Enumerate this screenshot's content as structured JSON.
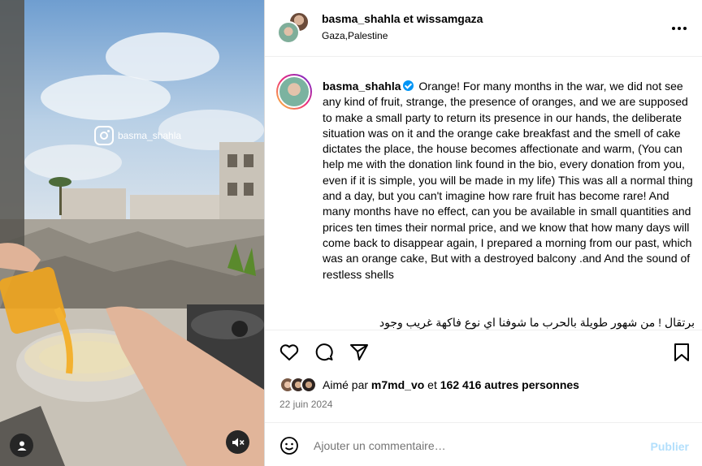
{
  "media": {
    "watermark_text": "basma_shahla",
    "user_tag_icon": "user-icon",
    "mute_icon": "speaker-muted-icon"
  },
  "header": {
    "authors": "basma_shahla et wissamgaza",
    "location": "Gaza,Palestine",
    "more_icon": "more-options-icon"
  },
  "caption": {
    "username": "basma_shahla",
    "text": "Orange! For many months in the war, we did not see any kind of fruit, strange, the presence of oranges, and we are supposed to make a small party to return its presence in our hands, the deliberate situation was on it and the orange cake breakfast and the smell of cake dictates the place, the house becomes affectionate and warm, (You can help me with the donation link found in the bio, every donation from you, even if it is simple, you will be made in my life) This was all a normal thing and a day, but you can't imagine how rare fruit has become rare! And many months have no effect, can you be available in small quantities and prices ten times their normal price, and we know that how many days will come back to disappear again, I prepared a morning from our past, which was an orange cake, But with a destroyed balcony .and And the sound of restless shells",
    "arabic_preview": "برتقال ! من شهور طويلة بالحرب ما شوفنا اي نوع فاكهة غريب وجود"
  },
  "actions": {
    "like_icon": "heart-icon",
    "comment_icon": "comment-icon",
    "share_icon": "share-icon",
    "save_icon": "bookmark-icon"
  },
  "likes": {
    "prefix": "Aimé par",
    "user": "m7md_vo",
    "conj": "et",
    "count": "162 416 autres personnes"
  },
  "date": "22 juin 2024",
  "comment": {
    "placeholder": "Ajouter un commentaire…",
    "publish_label": "Publier",
    "emoji_icon": "emoji-icon"
  },
  "colors": {
    "verified": "#0095f6",
    "publish_disabled": "#b2dffc",
    "muted_text": "#737373"
  }
}
